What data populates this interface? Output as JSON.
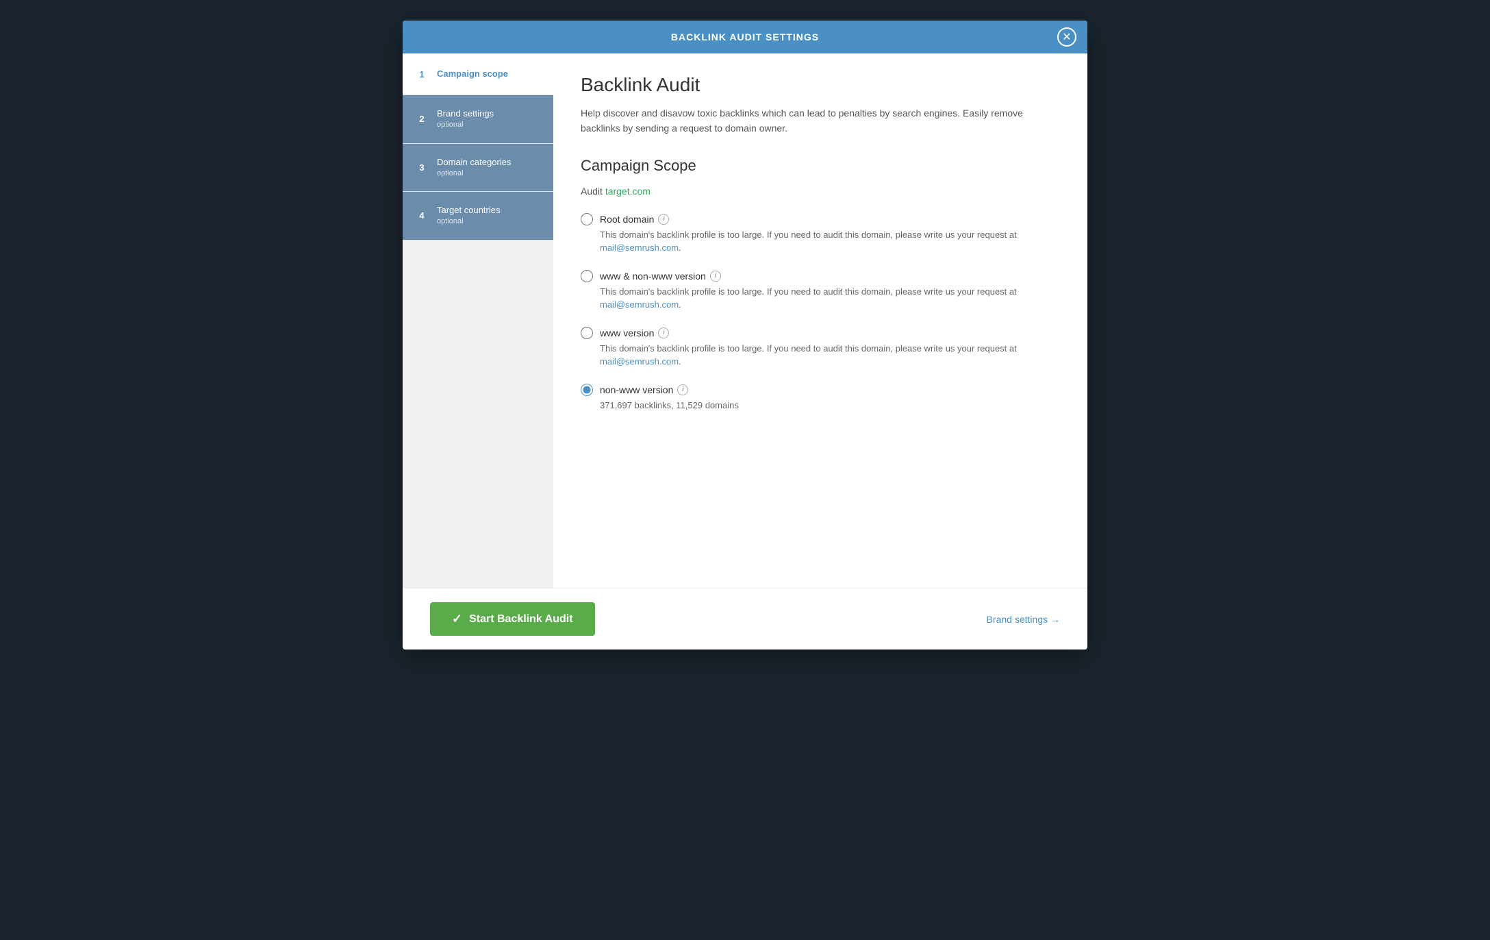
{
  "modal": {
    "header_title": "BACKLINK AUDIT SETTINGS",
    "close_aria": "Close"
  },
  "sidebar": {
    "items": [
      {
        "number": "1",
        "label": "Campaign scope",
        "sublabel": "",
        "active": true
      },
      {
        "number": "2",
        "label": "Brand settings",
        "sublabel": "optional",
        "active": false
      },
      {
        "number": "3",
        "label": "Domain categories",
        "sublabel": "optional",
        "active": false
      },
      {
        "number": "4",
        "label": "Target countries",
        "sublabel": "optional",
        "active": false
      }
    ]
  },
  "main": {
    "page_title": "Backlink Audit",
    "description": "Help discover and disavow toxic backlinks which can lead to penalties by search engines. Easily remove backlinks by sending a request to domain owner.",
    "section_title": "Campaign Scope",
    "audit_label": "Audit",
    "audit_domain": "target.com",
    "radio_options": [
      {
        "id": "root-domain",
        "label": "Root domain",
        "desc": "This domain's backlink profile is too large. If you need to audit this domain, please write us your request at ",
        "email": "mail@semrush.com",
        "email_suffix": ".",
        "selected": false
      },
      {
        "id": "www-non-www",
        "label": "www & non-www version",
        "desc": "This domain's backlink profile is too large. If you need to audit this domain, please write us your request at ",
        "email": "mail@semrush.com",
        "email_suffix": ".",
        "selected": false
      },
      {
        "id": "www-version",
        "label": "www version",
        "desc": "This domain's backlink profile is too large. If you need to audit this domain, please write us your request at ",
        "email": "mail@semrush.com",
        "email_suffix": ".",
        "selected": false
      },
      {
        "id": "non-www",
        "label": "non-www version",
        "desc": "371,697 backlinks, 11,529 domains",
        "email": "",
        "email_suffix": "",
        "selected": true
      }
    ]
  },
  "footer": {
    "start_button_label": "Start Backlink Audit",
    "brand_settings_label": "Brand settings →"
  }
}
